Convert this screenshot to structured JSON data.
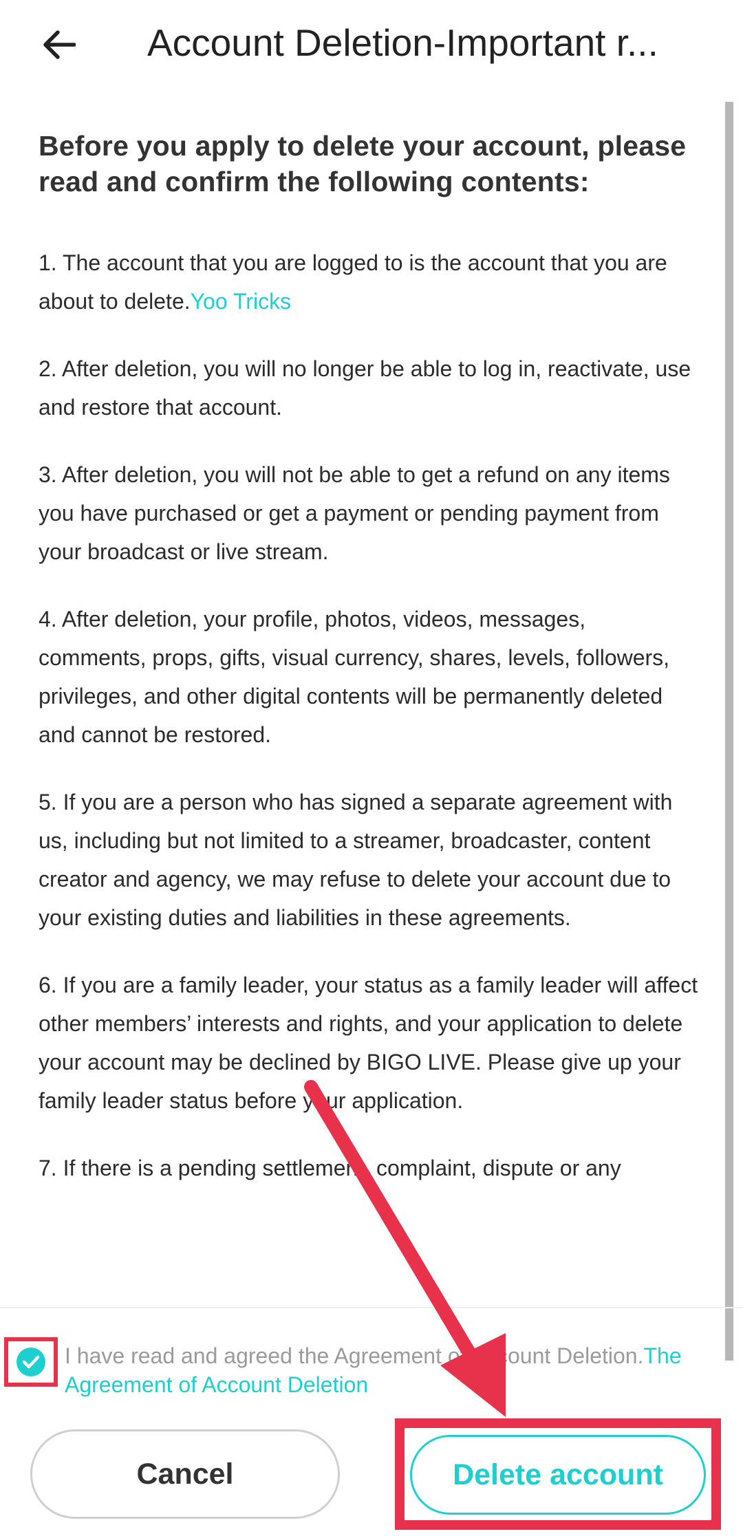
{
  "header": {
    "title": "Account Deletion-Important r..."
  },
  "content": {
    "intro": "Before you apply to delete your account, please read and confirm the following contents:",
    "items": [
      {
        "text": "1. The account that you are logged to is the account that you are about to delete.",
        "link": "Yoo Tricks"
      },
      {
        "text": "2. After deletion, you will no longer be able to log in, reactivate, use and restore that account."
      },
      {
        "text": "3. After deletion, you will not be able to get a refund on any items you have purchased or get a payment or pending payment from your broadcast or live stream."
      },
      {
        "text": "4. After deletion, your profile, photos, videos, messages, comments, props, gifts, visual currency, shares, levels, followers, privileges, and other digital contents will be permanently deleted and cannot be restored."
      },
      {
        "text": "5. If you are a person who has signed a separate agreement with us, including but not limited to a streamer, broadcaster, content creator and agency, we may refuse to delete your account due to your existing duties and liabilities in these agreements."
      },
      {
        "text": "6. If you are a family leader, your status as a family leader will affect other members’ interests and rights, and your application to delete your account may be declined by BIGO LIVE. Please give up your family leader status before your application."
      },
      {
        "text": "7. If there is a pending settlement, complaint, dispute or any"
      }
    ]
  },
  "agreement": {
    "text": "I have read and agreed the Agreement of Account Deletion.",
    "link": "The Agreement of Account Deletion",
    "checked": true
  },
  "buttons": {
    "cancel": "Cancel",
    "delete": "Delete account"
  },
  "colors": {
    "accent": "#1ecfcf",
    "annotation": "#e8324b"
  }
}
